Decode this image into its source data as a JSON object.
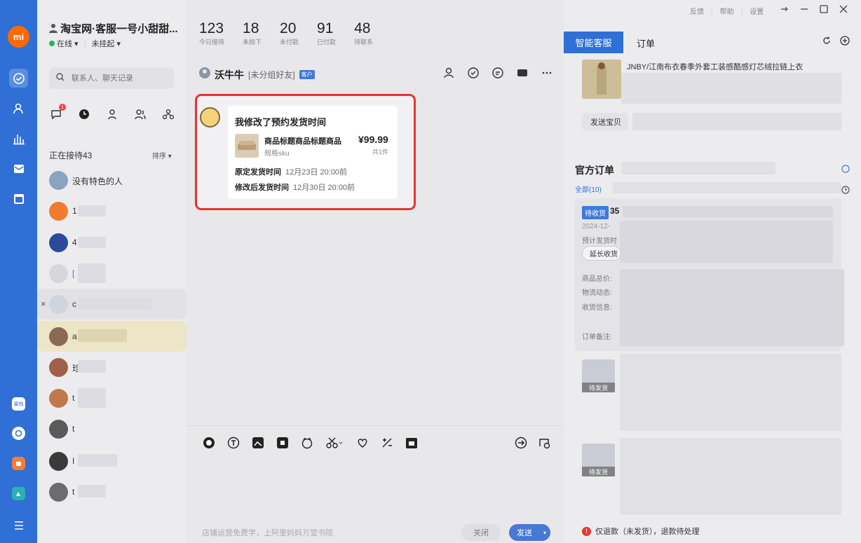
{
  "rail": {
    "logo": "mi",
    "apps": [
      "果饰",
      "",
      "",
      ""
    ],
    "menu_icon": "menu-icon"
  },
  "contacts": {
    "shop_title": "淘宝网·客服一号小甜甜...",
    "status_online": "在线",
    "status_hold": "未挂起",
    "search_placeholder": "联系人、聊天记录",
    "unread_badge": "1",
    "serving_label": "正在接待43",
    "sort_label": "排序",
    "items": [
      {
        "name": "没有特色的人"
      },
      {
        "name": "1"
      },
      {
        "name": "4"
      },
      {
        "name": "["
      },
      {
        "name": "c"
      },
      {
        "name": "a"
      },
      {
        "name": "珍"
      },
      {
        "name": "t"
      },
      {
        "name": "t"
      },
      {
        "name": "I"
      },
      {
        "name": "t"
      }
    ]
  },
  "stats": [
    {
      "num": "123",
      "label": "今日接待"
    },
    {
      "num": "18",
      "label": "未拍下"
    },
    {
      "num": "20",
      "label": "未付款"
    },
    {
      "num": "91",
      "label": "已付款"
    },
    {
      "num": "48",
      "label": "待联系"
    }
  ],
  "chat": {
    "contact_name": "沃牛牛",
    "group": "[未分组好友]",
    "tag": "客户",
    "message": {
      "title": "我修改了预约发货时间",
      "product_name": "商品标题商品标题商品",
      "sku": "规格sku",
      "price": "¥99.99",
      "qty": "共1件",
      "orig_label": "原定发货时间",
      "orig_time": "12月23日 20:00前",
      "new_label": "修改后发货时间",
      "new_time": "12月30日 20:00前"
    },
    "placeholder": "店铺运营免费学，上阿里妈妈万堂书院",
    "close_label": "关闭",
    "send_label": "发送"
  },
  "right": {
    "topbar": [
      "反馈",
      "帮助",
      "设置"
    ],
    "tab_smart": "智能客服",
    "tab_order": "订单",
    "product_title": "JNBY/江南布衣春季外套工装感酷感灯芯绒拉链上衣",
    "send_product": "发送宝贝",
    "orders_title": "官方订单",
    "all_orders": "全部(10)",
    "pending_tag": "待收货",
    "order_num": "35",
    "order_date": "2024-12-",
    "order_est": "预计发货时",
    "extend_label": "延长收货",
    "info_labels": [
      "商品总价:",
      "物流动态:",
      "收货信息:",
      "订单备注:"
    ],
    "person_tag": "待发货",
    "refund_text": "仅退款（未发货），退款待处理"
  },
  "colors": {
    "accent": "#2f6fd6",
    "highlight": "#e5352f",
    "badge": "#f5404b"
  }
}
